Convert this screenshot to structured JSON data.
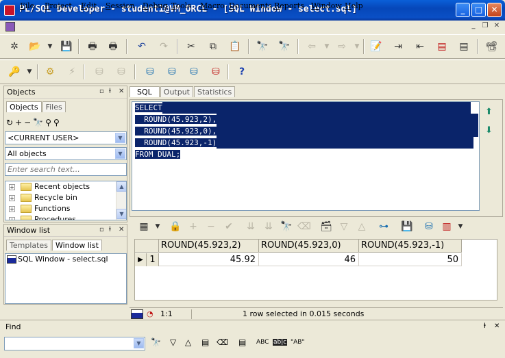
{
  "window": {
    "title": "PL/SQL Developer - student1@VM_ORCL - [SQL Window - select.sql]",
    "minimize_glyph": "_",
    "maximize_glyph": "□",
    "close_glyph": "✕"
  },
  "menu": [
    "File",
    "Project",
    "Edit",
    "Session",
    "Debug",
    "Tools",
    "Macro",
    "Documents",
    "Reports",
    "Window",
    "Help"
  ],
  "objects_panel": {
    "title": "Objects",
    "tabs": [
      "Objects",
      "Files"
    ],
    "user_combo": "<CURRENT USER>",
    "filter_combo": "All objects",
    "search_placeholder": "Enter search text...",
    "tree": [
      "Recent objects",
      "Recycle bin",
      "Functions",
      "Procedures"
    ]
  },
  "window_list_panel": {
    "title": "Window list",
    "tabs": [
      "Templates",
      "Window list"
    ],
    "items": [
      "SQL Window - select.sql"
    ]
  },
  "editor_tabs": [
    "SQL",
    "Output",
    "Statistics"
  ],
  "sql_lines": [
    "SELECT",
    "  ROUND(45.923,2),",
    "  ROUND(45.923,0),",
    "  ROUND(45.923,-1)",
    "FROM DUAL;"
  ],
  "grid": {
    "columns": [
      "ROUND(45.923,2)",
      "ROUND(45.923,0)",
      "ROUND(45.923,-1)"
    ],
    "rows": [
      {
        "row_num": "1",
        "values": [
          "45.92",
          "46",
          "50"
        ]
      }
    ],
    "row_indicator": "▶"
  },
  "status": {
    "position": "1:1",
    "message": "1 row selected in 0.015 seconds"
  },
  "find_panel": {
    "title": "Find",
    "options": [
      "ABC",
      "ab|c",
      "\"AB\""
    ]
  },
  "colors": {
    "titlebar": "#0a4fc5",
    "selection": "#0a246a",
    "chrome": "#ece9d8"
  }
}
